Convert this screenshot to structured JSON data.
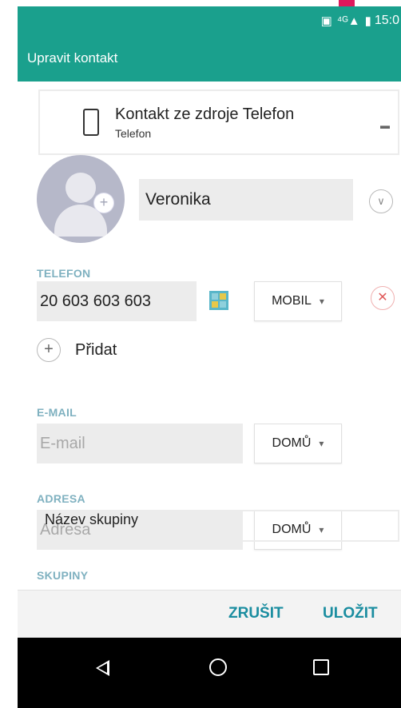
{
  "status_bar": {
    "nfc_icon": "nfc-icon",
    "signal_text": "⁴ᴳ▲",
    "battery_icon": "battery-icon",
    "time": "15:0"
  },
  "app_bar": {
    "title": "Upravit kontakt"
  },
  "source": {
    "title": "Kontakt ze zdroje Telefon",
    "subtitle": "Telefon"
  },
  "name": {
    "value": "Veronika"
  },
  "phone": {
    "label": "TELEFON",
    "value": "20 603 603 603",
    "type": "MOBIL",
    "add_label": "Přidat"
  },
  "email": {
    "label": "E-MAIL",
    "placeholder": "E-mail",
    "type": "DOMŮ"
  },
  "address": {
    "label": "ADRESA",
    "placeholder": "Adresa",
    "type": "DOMŮ"
  },
  "groups": {
    "label": "SKUPINY",
    "placeholder": "Název skupiny"
  },
  "actions": {
    "cancel": "ZRUŠIT",
    "save": "ULOŽIT"
  },
  "colors": {
    "accent": "#1aa08d",
    "section_label": "#7fb1c0",
    "action_text": "#1a8da0",
    "remove": "#e05a5a"
  }
}
